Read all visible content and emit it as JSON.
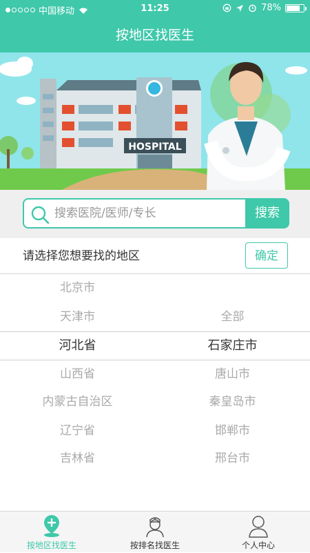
{
  "status": {
    "carrier": "中国移动",
    "time": "11:25",
    "battery": "78%",
    "battery_level": 0.78
  },
  "nav": {
    "title": "按地区找医生"
  },
  "banner": {
    "sign": "HOSPITAL"
  },
  "search": {
    "placeholder": "搜索医院/医师/专长",
    "button": "搜索"
  },
  "region": {
    "prompt": "请选择您想要找的地区",
    "confirm": "确定"
  },
  "picker": {
    "provinces": [
      "北京市",
      "天津市",
      "河北省",
      "山西省",
      "内蒙古自治区",
      "辽宁省",
      "吉林省"
    ],
    "selected_province": "河北省",
    "cities": [
      "全部",
      "石家庄市",
      "唐山市",
      "秦皇岛市",
      "邯郸市",
      "邢台市"
    ],
    "selected_city": "石家庄市"
  },
  "tabs": [
    {
      "label": "按地区找医生",
      "active": true
    },
    {
      "label": "按排名找医生",
      "active": false
    },
    {
      "label": "个人中心",
      "active": false
    }
  ],
  "colors": {
    "accent": "#3fc8aa",
    "muted": "#aaaaaa",
    "text": "#333333"
  }
}
